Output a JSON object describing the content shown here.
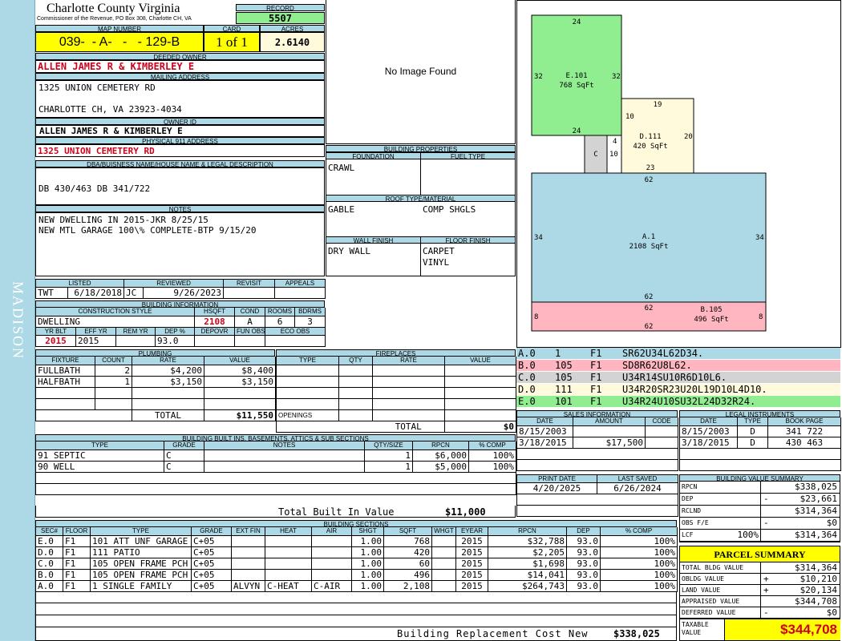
{
  "county": {
    "title": "Charlotte County Virginia",
    "subtitle": "Commissioner of the Revenue, PO Box 308, Charlotte CH, VA"
  },
  "sidebar": {
    "label": "MADISON"
  },
  "record": {
    "label": "RECORD",
    "value": "5507"
  },
  "map": {
    "label": "MAP NUMBER",
    "value": "039-  - A-   -   - 129-B",
    "card_label": "CARD",
    "card_value": "1 of 1",
    "acres_label": "ACRES",
    "acres_value": "2.6140"
  },
  "owner": {
    "label": "DEEDED OWNER",
    "value": "ALLEN JAMES R & KIMBERLEY E"
  },
  "mailing": {
    "label": "MAILING ADDRESS",
    "line1": "1325 UNION CEMETERY RD",
    "line2": "CHARLOTTE CH, VA 23923-4034"
  },
  "owner_id": {
    "label": "OWNER ID",
    "value": "ALLEN JAMES R & KIMBERLEY E"
  },
  "physical": {
    "label": "PHYSICAL 911 ADDRESS",
    "value": "1325 UNION CEMETERY RD"
  },
  "legal": {
    "label": "DBA/BUISNESS NAME/HOUSE NAME & LEGAL DESCRIPTION",
    "value": "DB 430/463 DB 341/722"
  },
  "notes": {
    "label": "NOTES",
    "line1": "NEW DWELLING IN 2015-JKR 8/25/15",
    "line2": "NEW MTL GARAGE 100\\% COMPLETE-BTP 9/15/20"
  },
  "listing": {
    "listed_label": "LISTED",
    "reviewed_label": "REVIEWED",
    "revisit_label": "REVISIT",
    "appeals_label": "APPEALS",
    "listed_by": "TWT",
    "listed_date": "6/18/2018",
    "reviewed_by": "JC",
    "reviewed_date": "9/26/2023"
  },
  "building_info": {
    "label": "BUILDING INFORMATION",
    "cols1": [
      "CONSTRUCTION STYLE",
      "HSQFT",
      "COND",
      "ROOMS",
      "BDRMS"
    ],
    "row1": [
      "DWELLING",
      "2108",
      "A",
      "6",
      "3"
    ],
    "cols2": [
      "YR BLT",
      "EFF YR",
      "REM YR",
      "DEP %",
      "DEPOVR",
      "FUN OBS",
      "ECO OBS"
    ],
    "row2": [
      "2015",
      "2015",
      "",
      "93.0",
      "",
      "",
      ""
    ]
  },
  "image": {
    "placeholder": "No Image Found"
  },
  "building_props": {
    "label": "BUILDING PROPERTIES",
    "foundation_label": "FOUNDATION",
    "fuel_label": "FUEL TYPE",
    "foundation": "CRAWL",
    "fuel": "",
    "roof_label": "ROOF TYPE/MATERIAL",
    "roof_type": "GABLE",
    "roof_material": "COMP SHGLS",
    "wall_label": "WALL FINISH",
    "floor_label": "FLOOR FINISH",
    "wall": "DRY WALL",
    "floor1": "CARPET",
    "floor2": "VINYL"
  },
  "plumbing": {
    "label": "PLUMBING",
    "headers": [
      "FIXTURE",
      "COUNT",
      "RATE",
      "VALUE"
    ],
    "rows": [
      [
        "FULLBATH",
        "2",
        "$4,200",
        "$8,400"
      ],
      [
        "HALFBATH",
        "1",
        "$3,150",
        "$3,150"
      ]
    ],
    "total_label": "TOTAL",
    "total": "$11,550"
  },
  "fireplaces": {
    "label": "FIREPLACES",
    "headers": [
      "TYPE",
      "QTY",
      "RATE",
      "VALUE"
    ],
    "openings_label": "OPENINGS",
    "total_label": "TOTAL",
    "total": "$0"
  },
  "builtins": {
    "label": "BUILDING BUILT INS, BASEMENTS, ATTICS & SUB SECTIONS",
    "headers": [
      "TYPE",
      "GRADE",
      "NOTES",
      "QTY/SIZE",
      "RPCN",
      "% COMP"
    ],
    "rows": [
      [
        "91 SEPTIC",
        "C",
        "",
        "1",
        "$6,000",
        "100%"
      ],
      [
        "90 WELL",
        "C",
        "",
        "1",
        "$5,000",
        "100%"
      ]
    ],
    "total_label": "Total Built In Value",
    "total": "$11,000"
  },
  "sections": {
    "label": "BUILDING SECTIONS",
    "headers": [
      "SEC#",
      "FLOOR",
      "TYPE",
      "GRADE",
      "EXT FIN",
      "HEAT",
      "AIR",
      "SHGT",
      "SQFT",
      "WHGT",
      "EYEAR",
      "RPCN",
      "DEP",
      "% COMP"
    ],
    "rows": [
      [
        "E.0",
        "F1",
        "101 ATT UNF GARAGE",
        "C+05",
        "",
        "",
        "",
        "1.00",
        "768",
        "",
        "2015",
        "$32,788",
        "93.0",
        "100%"
      ],
      [
        "D.0",
        "F1",
        "111 PATIO",
        "C+05",
        "",
        "",
        "",
        "1.00",
        "420",
        "",
        "2015",
        "$2,205",
        "93.0",
        "100%"
      ],
      [
        "C.0",
        "F1",
        "105 OPEN FRAME PCH",
        "C+05",
        "",
        "",
        "",
        "1.00",
        "60",
        "",
        "2015",
        "$1,698",
        "93.0",
        "100%"
      ],
      [
        "B.0",
        "F1",
        "105 OPEN FRAME PCH",
        "C+05",
        "",
        "",
        "",
        "1.00",
        "496",
        "",
        "2015",
        "$14,041",
        "93.0",
        "100%"
      ],
      [
        "A.0",
        "F1",
        "1 SINGLE FAMILY",
        "C+05",
        "ALVYN",
        "C-HEAT",
        "C-AIR",
        "1.00",
        "2,108",
        "",
        "2015",
        "$264,743",
        "93.0",
        "100%"
      ]
    ],
    "total_label": "Building Replacement Cost New",
    "total": "$338,025"
  },
  "sketch": {
    "areas": [
      {
        "id": "E.101",
        "sqft": "768 SqFt",
        "color": "#90ee90",
        "dims": [
          "24",
          "32",
          "32",
          "24"
        ]
      },
      {
        "id": "D.111",
        "sqft": "420 SqFt",
        "color": "#fffadc",
        "dims": [
          "19",
          "20",
          "23",
          "10",
          "4",
          "10"
        ]
      },
      {
        "id": "C",
        "sqft": "",
        "color": "#d3d3d3",
        "dims": []
      },
      {
        "id": "A.1",
        "sqft": "2108 SqFt",
        "color": "#add8e6",
        "dims": [
          "62",
          "34",
          "34",
          "62"
        ]
      },
      {
        "id": "B.105",
        "sqft": "496 SqFt",
        "color": "#ffb6c1",
        "dims": [
          "62",
          "8",
          "8",
          "62"
        ]
      }
    ]
  },
  "vectors": [
    {
      "sec": "A.0",
      "code": "1",
      "floor": "F1",
      "path": "SR62U34L62D34.",
      "color": "#add8e6"
    },
    {
      "sec": "B.0",
      "code": "105",
      "floor": "F1",
      "path": "SD8R62U8L62.",
      "color": "#ffb6c1"
    },
    {
      "sec": "C.0",
      "code": "105",
      "floor": "F1",
      "path": "U34R14SU10R6D10L6.",
      "color": "#d3d3d3"
    },
    {
      "sec": "D.0",
      "code": "111",
      "floor": "F1",
      "path": "U34R20SR23U20L19D10L4D10.",
      "color": "#fffadc"
    },
    {
      "sec": "E.0",
      "code": "101",
      "floor": "F1",
      "path": "U34R24U10SU32L24D32R24.",
      "color": "#90ee90"
    }
  ],
  "sales": {
    "label": "SALES INFORMATION",
    "headers": [
      "DATE",
      "AMOUNT",
      "CODE"
    ],
    "rows": [
      [
        "8/15/2003",
        "",
        ""
      ],
      [
        "3/18/2015",
        "$17,500",
        ""
      ]
    ]
  },
  "legal_instruments": {
    "label": "LEGAL INSTRUMENTS",
    "headers": [
      "DATE",
      "TYPE",
      "BOOK PAGE"
    ],
    "rows": [
      [
        "8/15/2003",
        "D",
        "341 722"
      ],
      [
        "3/18/2015",
        "D",
        "430 463"
      ]
    ]
  },
  "print": {
    "print_label": "PRINT DATE",
    "saved_label": "LAST SAVED",
    "print_date": "4/20/2025",
    "saved_date": "6/26/2024"
  },
  "value_summary": {
    "label": "BUILDING VALUE SUMMARY",
    "rows": [
      {
        "label": "RPCN",
        "sign": "",
        "value": "$338,025"
      },
      {
        "label": "DEP",
        "sign": "-",
        "value": "$23,661"
      },
      {
        "label": "RCLND",
        "sign": "",
        "value": "$314,364"
      },
      {
        "label": "OBS F/E",
        "sign": "-",
        "value": "$0"
      },
      {
        "label": "LCF",
        "pct": "100%",
        "sign": "",
        "value": "$314,364"
      }
    ]
  },
  "parcel": {
    "label": "PARCEL SUMMARY",
    "rows": [
      {
        "label": "TOTAL BLDG VALUE",
        "sign": "",
        "value": "$314,364"
      },
      {
        "label": "OBLDG VALUE",
        "sign": "+",
        "value": "$10,210"
      },
      {
        "label": "LAND VALUE",
        "sign": "+",
        "value": "$20,134"
      },
      {
        "label": "APPRAISED VALUE",
        "sign": "",
        "value": "$344,708"
      },
      {
        "label": "DEFERRED VALUE",
        "sign": "-",
        "value": "$0"
      }
    ],
    "taxable_label": "TAXABLE VALUE",
    "taxable": "$344,708"
  }
}
